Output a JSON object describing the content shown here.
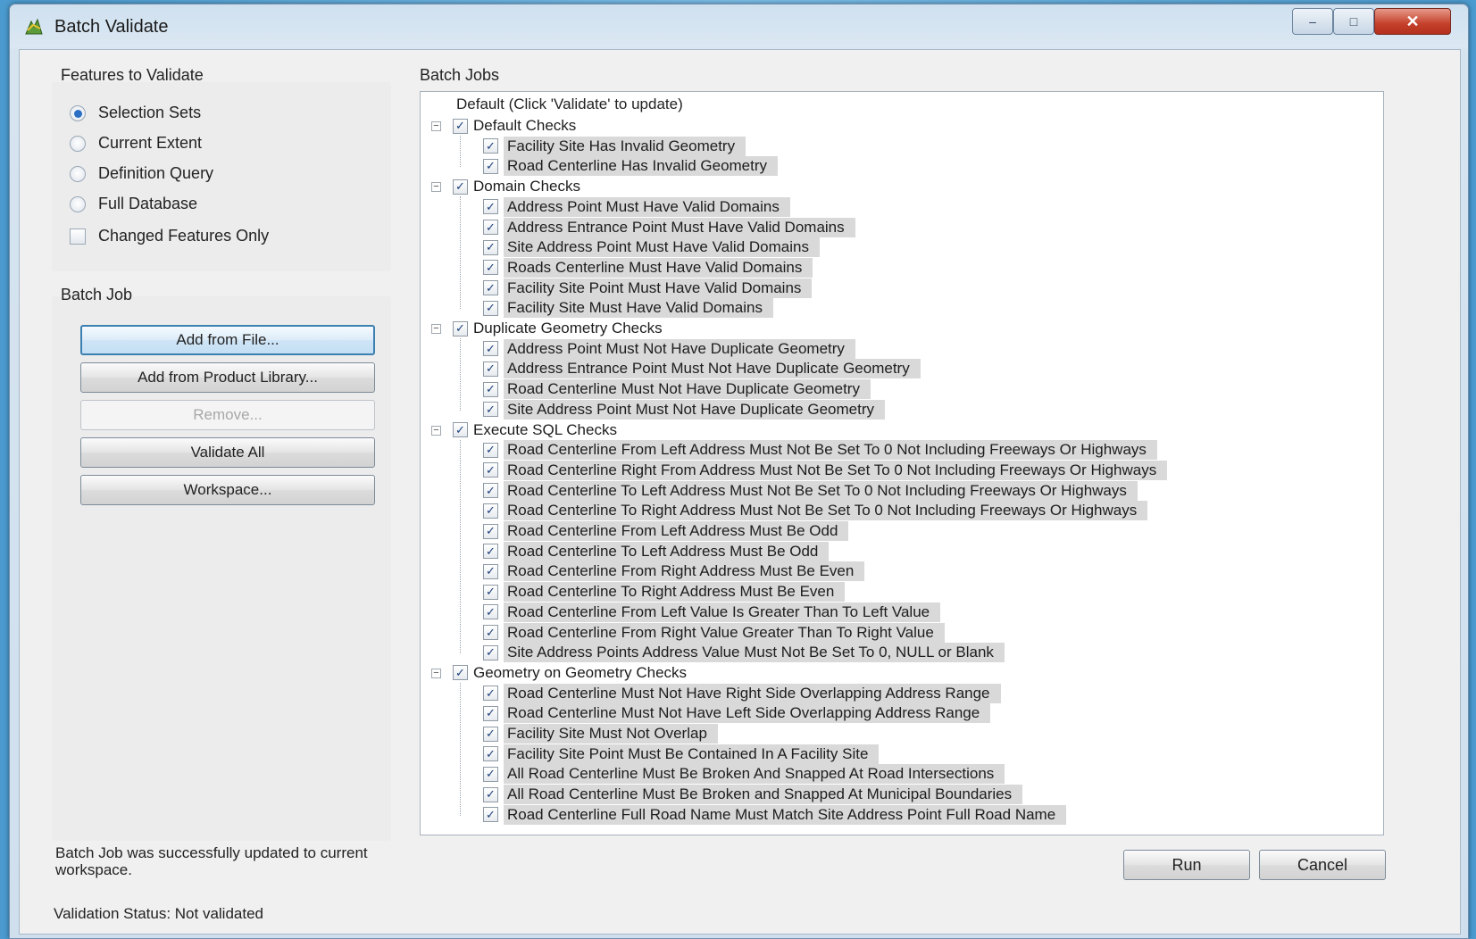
{
  "window": {
    "title": "Batch Validate",
    "controls": {
      "minimize": "–",
      "maximize": "□",
      "close": "✕"
    }
  },
  "features": {
    "title": "Features to Validate",
    "options": [
      {
        "label": "Selection Sets",
        "selected": true
      },
      {
        "label": "Current Extent",
        "selected": false
      },
      {
        "label": "Definition Query",
        "selected": false
      },
      {
        "label": "Full Database",
        "selected": false
      }
    ],
    "changed_only": {
      "label": "Changed Features Only",
      "checked": false
    }
  },
  "batch_job": {
    "title": "Batch Job",
    "buttons": {
      "add_from_file": "Add from File...",
      "add_from_library": "Add from Product Library...",
      "remove": "Remove...",
      "validate_all": "Validate All",
      "workspace": "Workspace..."
    },
    "message": "Batch Job was successfully updated to current workspace.",
    "validation_status": "Validation Status: Not validated"
  },
  "batch_jobs": {
    "title": "Batch Jobs",
    "root": "Default (Click 'Validate' to update)",
    "groups": [
      {
        "label": "Default Checks",
        "items": [
          "Facility Site Has Invalid Geometry",
          "Road Centerline Has Invalid Geometry"
        ]
      },
      {
        "label": "Domain Checks",
        "items": [
          "Address Point Must Have Valid Domains",
          "Address Entrance Point Must Have Valid Domains",
          "Site Address Point Must Have Valid Domains",
          "Roads Centerline Must Have Valid Domains",
          "Facility Site Point Must Have Valid Domains",
          "Facility Site Must Have Valid Domains"
        ]
      },
      {
        "label": "Duplicate Geometry Checks",
        "items": [
          "Address Point Must Not Have Duplicate Geometry",
          "Address Entrance Point Must Not Have Duplicate Geometry",
          "Road Centerline Must Not Have Duplicate Geometry",
          "Site Address Point Must Not Have Duplicate Geometry"
        ]
      },
      {
        "label": "Execute SQL Checks",
        "items": [
          "Road Centerline From Left Address Must Not Be Set To 0 Not Including Freeways Or Highways",
          "Road Centerline Right From Address Must Not Be Set To 0 Not Including Freeways Or Highways",
          "Road Centerline To Left Address Must Not Be Set To 0 Not Including Freeways Or Highways",
          "Road Centerline To Right Address Must Not Be Set To 0 Not Including Freeways Or Highways",
          "Road Centerline From Left Address Must Be Odd",
          "Road Centerline To Left Address Must Be Odd",
          "Road Centerline From Right Address Must Be Even",
          "Road Centerline To Right Address Must Be Even",
          "Road Centerline From Left Value Is Greater Than To Left Value",
          "Road Centerline From Right Value Greater Than To Right Value",
          "Site Address Points Address Value Must Not Be Set To 0, NULL or Blank"
        ]
      },
      {
        "label": "Geometry on Geometry Checks",
        "items": [
          "Road Centerline Must Not Have Right Side Overlapping Address Range",
          "Road Centerline Must Not Have Left Side Overlapping Address Range",
          "Facility Site Must Not Overlap",
          "Facility Site Point Must Be Contained In A Facility Site",
          "All Road Centerline Must Be Broken And Snapped At Road Intersections",
          "All Road Centerline Must Be Broken and Snapped At Municipal Boundaries",
          "Road Centerline Full Road Name Must Match Site Address Point Full Road Name"
        ]
      }
    ]
  },
  "footer": {
    "run": "Run",
    "cancel": "Cancel"
  },
  "icons": {
    "check": "✓",
    "expander": "−"
  }
}
